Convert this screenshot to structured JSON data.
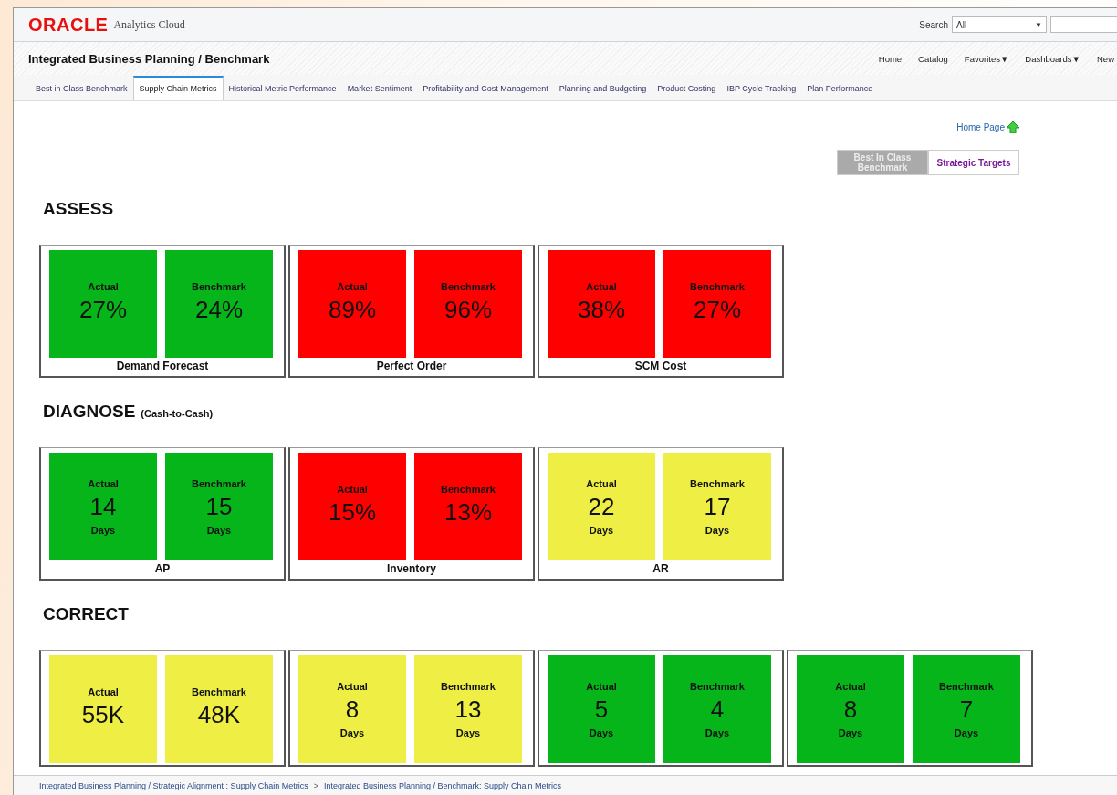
{
  "header": {
    "logo": "ORACLE",
    "product": "Analytics Cloud",
    "search_label": "Search",
    "search_scope": "All",
    "scope_caret": "▼"
  },
  "title": "Integrated Business Planning / Benchmark",
  "nav": [
    {
      "label": "Home"
    },
    {
      "label": "Catalog"
    },
    {
      "label": "Favorites",
      "caret": "▼"
    },
    {
      "label": "Dashboards",
      "caret": "▼"
    },
    {
      "label": "New"
    }
  ],
  "tabs": [
    {
      "label": "Best in Class Benchmark",
      "selected": false
    },
    {
      "label": "Supply Chain Metrics",
      "selected": true
    },
    {
      "label": "Historical Metric Performance",
      "selected": false
    },
    {
      "label": "Market Sentiment",
      "selected": false
    },
    {
      "label": "Profitability and Cost Management",
      "selected": false
    },
    {
      "label": "Planning and Budgeting",
      "selected": false
    },
    {
      "label": "Product Costing",
      "selected": false
    },
    {
      "label": "IBP Cycle Tracking",
      "selected": false
    },
    {
      "label": "Plan Performance",
      "selected": false
    }
  ],
  "home_link": "Home Page",
  "toggle": [
    {
      "label": "Best In Class Benchmark",
      "selected": true
    },
    {
      "label": "Strategic Targets",
      "selected": false
    }
  ],
  "sections": [
    {
      "title": "ASSESS",
      "cards": [
        {
          "name": "Demand Forecast",
          "tiles": [
            {
              "label": "Actual",
              "value": "27%",
              "color": "#06b51a"
            },
            {
              "label": "Benchmark",
              "value": "24%",
              "color": "#06b51a"
            }
          ]
        },
        {
          "name": "Perfect Order",
          "tiles": [
            {
              "label": "Actual",
              "value": "89%",
              "color": "#ff0000"
            },
            {
              "label": "Benchmark",
              "value": "96%",
              "color": "#ff0000"
            }
          ]
        },
        {
          "name": "SCM Cost",
          "tiles": [
            {
              "label": "Actual",
              "value": "38%",
              "color": "#ff0000"
            },
            {
              "label": "Benchmark",
              "value": "27%",
              "color": "#ff0000"
            }
          ]
        }
      ]
    },
    {
      "title": "DIAGNOSE",
      "subtitle": "(Cash-to-Cash)",
      "cards": [
        {
          "name": "AP",
          "tiles": [
            {
              "label": "Actual",
              "value": "14",
              "unit": "Days",
              "color": "#06b51a"
            },
            {
              "label": "Benchmark",
              "value": "15",
              "unit": "Days",
              "color": "#06b51a"
            }
          ]
        },
        {
          "name": "Inventory",
          "tiles": [
            {
              "label": "Actual",
              "value": "15%",
              "color": "#ff0000"
            },
            {
              "label": "Benchmark",
              "value": "13%",
              "color": "#ff0000"
            }
          ]
        },
        {
          "name": "AR",
          "tiles": [
            {
              "label": "Actual",
              "value": "22",
              "unit": "Days",
              "color": "#eeee44"
            },
            {
              "label": "Benchmark",
              "value": "17",
              "unit": "Days",
              "color": "#eeee44"
            }
          ]
        }
      ]
    },
    {
      "title": "CORRECT",
      "cards": [
        {
          "tiles": [
            {
              "label": "Actual",
              "value": "55K",
              "color": "#eeee44"
            },
            {
              "label": "Benchmark",
              "value": "48K",
              "color": "#eeee44"
            }
          ]
        },
        {
          "tiles": [
            {
              "label": "Actual",
              "value": "8",
              "unit": "Days",
              "color": "#eeee44"
            },
            {
              "label": "Benchmark",
              "value": "13",
              "unit": "Days",
              "color": "#eeee44"
            }
          ]
        },
        {
          "tiles": [
            {
              "label": "Actual",
              "value": "5",
              "unit": "Days",
              "color": "#06b51a"
            },
            {
              "label": "Benchmark",
              "value": "4",
              "unit": "Days",
              "color": "#06b51a"
            }
          ]
        },
        {
          "tiles": [
            {
              "label": "Actual",
              "value": "8",
              "unit": "Days",
              "color": "#06b51a"
            },
            {
              "label": "Benchmark",
              "value": "7",
              "unit": "Days",
              "color": "#06b51a"
            }
          ]
        }
      ]
    }
  ],
  "breadcrumb": [
    {
      "label": "Integrated Business Planning / Strategic Alignment : Supply Chain Metrics"
    },
    {
      "label": "Integrated Business Planning / Benchmark: Supply Chain Metrics"
    }
  ],
  "breadcrumb_separator": ">"
}
